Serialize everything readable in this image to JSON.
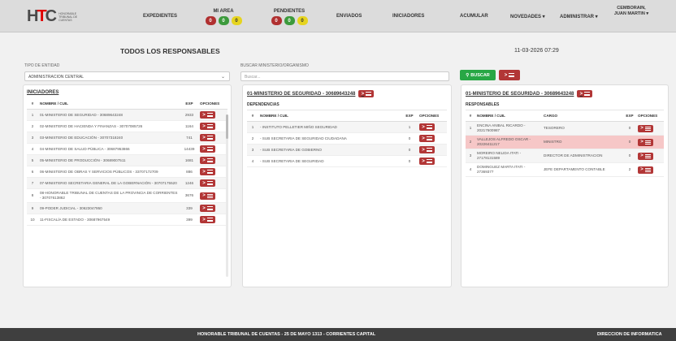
{
  "nav": {
    "logo_text": "HTC",
    "logo_subtitle": "Honorable Tribunal de Cuentas",
    "expedientes": "EXPEDIENTES",
    "mi_area": "MI AREA",
    "mi_area_badges": [
      "0",
      "0",
      "0"
    ],
    "pendientes": "PENDIENTES",
    "pendientes_badges": [
      "0",
      "0",
      "0"
    ],
    "enviados": "ENVIADOS",
    "iniciadores": "INICIADORES",
    "acumular": "ACUMULAR",
    "novedades": "NOVEDADES",
    "administrar": "ADMINISTRAR",
    "user": "CEMBORAIN, JUAN MARTIN",
    "badge_colors": [
      "#b03030",
      "#3c9a3c",
      "#e6d41f"
    ]
  },
  "page": {
    "title": "TODOS LOS RESPONSABLES",
    "datetime": "11-03-2026 07:29"
  },
  "filters": {
    "entity_label": "TIPO DE ENTIDAD",
    "entity_value": "ADMINISTRACION CENTRAL",
    "search_label": "BUSCAR MINISTERIO/ORGANISMO",
    "search_placeholder": "Buscar...",
    "search_button": "BUSCAR"
  },
  "iniciadores": {
    "title": "INICIADORES",
    "columns": [
      "#",
      "NOMBRE / CUIL",
      "EXP",
      "OPCIONES"
    ],
    "rows": [
      {
        "n": "1",
        "name": "01-MINISTERIO DE SEGURIDAD - 30689643248",
        "exp": "2933"
      },
      {
        "n": "2",
        "name": "02-MINISTERIO DE HACIENDA Y FINANZAS - 30707085726",
        "exp": "1164"
      },
      {
        "n": "3",
        "name": "03-MINISTERIO DE EDUCACIÓN - 30707318240",
        "exp": "741"
      },
      {
        "n": "4",
        "name": "04-MINISTERIO DE SALUD PÚBLICA - 30687953866",
        "exp": "14439"
      },
      {
        "n": "5",
        "name": "05-MINISTERIO DE PRODUCCIÓN - 30689007511",
        "exp": "1681"
      },
      {
        "n": "6",
        "name": "06-MINISTERIO DE OBRAS Y SERVICIOS PÚBLICOS - 33707172709",
        "exp": "886"
      },
      {
        "n": "7",
        "name": "07-MINISTERIO SECRETARIA GENERAL DE LA GOBERNACIÓN - 30707175520",
        "exp": "1246"
      },
      {
        "n": "8",
        "name": "08-HONORABLE TRIBUNAL DE CUENTAS DE LA PROVINCIA DE CORRIENTES - 30707613862",
        "exp": "3676"
      },
      {
        "n": "9",
        "name": "09-PODER JUDICIAL - 30623047950",
        "exp": "339"
      },
      {
        "n": "10",
        "name": "11-FISCALÍA DE ESTADO - 30687967549",
        "exp": "399"
      }
    ]
  },
  "dependencias": {
    "title": "01-MINISTERIO DE SEGURIDAD - 30689643248",
    "subtitle": "DEPENDENCIAS",
    "columns": [
      "#",
      "NOMBRE / CUIL",
      "EXP",
      "OPCIONES"
    ],
    "rows": [
      {
        "n": "1",
        "name": "- INSTITUTO PELLETIER MIÑO SEGURIDAD",
        "exp": "1"
      },
      {
        "n": "2",
        "name": "- SUB SECRETARIA DE SEGURIDAD CIUDADANA",
        "exp": "0"
      },
      {
        "n": "3",
        "name": "- SUB SECRETARIA DE GOBIERNO",
        "exp": "0"
      },
      {
        "n": "4",
        "name": "- SUB SECRETARIA DE SEGURIDAD",
        "exp": "0"
      }
    ]
  },
  "responsables": {
    "title": "01-MINISTERIO DE SEGURIDAD - 30689643248",
    "subtitle": "RESPONSABLES",
    "columns": [
      "#",
      "NOMBRE / CUIL",
      "CARGO",
      "EXP",
      "OPCIONES"
    ],
    "rows": [
      {
        "n": "1",
        "name": "ENCINA ANIBAL RICARDO - 20217600987",
        "cargo": "TESORERO",
        "exp": "0"
      },
      {
        "n": "2",
        "name": "VALLEJOS ALFREDO OSCAR - 20226411217",
        "cargo": "MINISTRO",
        "exp": "0"
      },
      {
        "n": "3",
        "name": "MOREIRO NELIDA ITATI - 27178131589",
        "cargo": "DIRECTOR DE ADMINISTRACION",
        "exp": "0"
      },
      {
        "n": "4",
        "name": "DOMINGUEZ MARTA ITATI - 27369377",
        "cargo": "JEFE DEPARTAMENTO CONTABLE",
        "exp": "2"
      }
    ]
  },
  "footer": {
    "center": "HONORABLE TRIBUNAL DE CUENTAS - 25 DE MAYO 1313 - CORRIENTES CAPITAL",
    "right": "DIRECCION DE INFORMATICA"
  }
}
